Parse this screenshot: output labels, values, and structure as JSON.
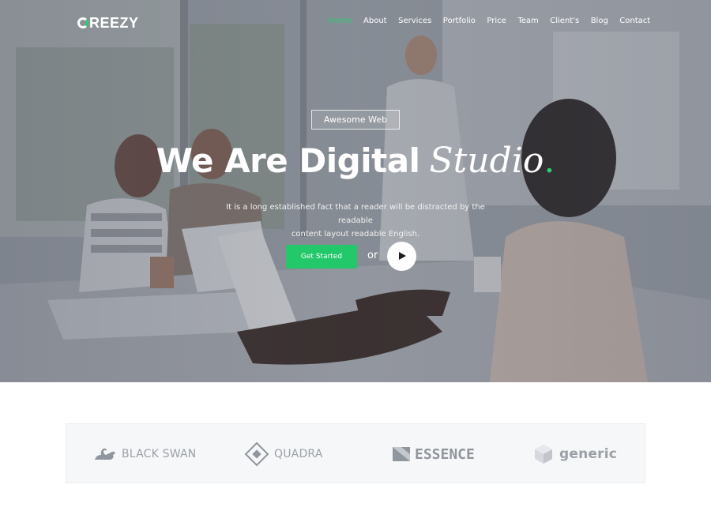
{
  "brand": {
    "name": "CREEZY",
    "accent_color": "#2ecc71"
  },
  "nav": {
    "items": [
      {
        "label": "Home",
        "active": true
      },
      {
        "label": "About"
      },
      {
        "label": "Services"
      },
      {
        "label": "Portfolio"
      },
      {
        "label": "Price"
      },
      {
        "label": "Team"
      },
      {
        "label": "Client's"
      },
      {
        "label": "Blog"
      },
      {
        "label": "Contact"
      }
    ]
  },
  "hero": {
    "badge": "Awesome Web",
    "headline_main": "We Are Digital",
    "headline_script": "Studio",
    "headline_dot": ".",
    "subtitle_line1": "It is a long established fact that a reader will be distracted by the readable",
    "subtitle_line2": "content layout readable English.",
    "cta_label": "Get Started",
    "or_label": "or",
    "play_icon": "play-icon"
  },
  "clients": [
    {
      "name": "BLACK SWAN",
      "icon": "swan-icon"
    },
    {
      "name": "QUADRA",
      "icon": "diamond-icon"
    },
    {
      "name": "ESSENCE",
      "icon": "essence-flag-icon"
    },
    {
      "name": "generic",
      "icon": "cube-icon"
    }
  ]
}
